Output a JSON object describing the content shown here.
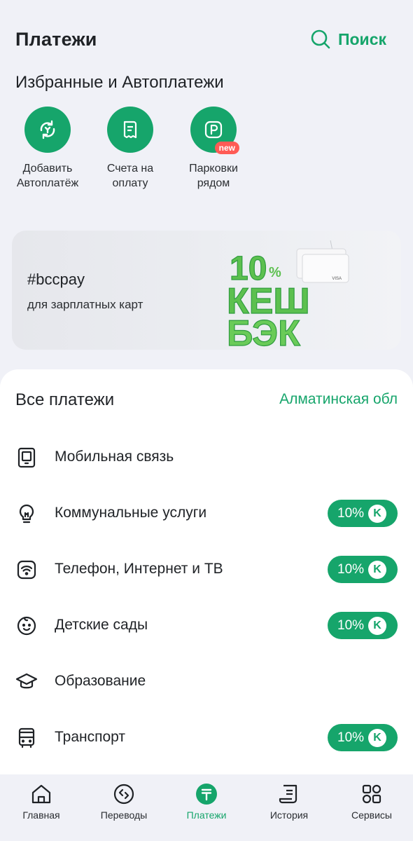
{
  "header": {
    "title": "Платежи",
    "search_label": "Поиск"
  },
  "favorites": {
    "title": "Избранные и Автоплатежи",
    "items": [
      {
        "label": "Добавить\nАвтоплатёж",
        "icon": "autopay-icon"
      },
      {
        "label": "Счета на\nоплату",
        "icon": "invoice-icon"
      },
      {
        "label": "Парковки\nрядом",
        "icon": "parking-icon",
        "badge": "new"
      }
    ]
  },
  "banner": {
    "tag": "#bccpay",
    "subtitle": "для зарплатных карт",
    "promo_percent": "10",
    "promo_percent_sign": "%",
    "promo_line1": "КЕШ",
    "promo_line2": "БЭК"
  },
  "all_payments": {
    "title": "Все платежи",
    "region": "Алматинская обл",
    "items": [
      {
        "label": "Мобильная связь",
        "icon": "mobile-phone-icon",
        "cashback": ""
      },
      {
        "label": "Коммунальные услуги",
        "icon": "lightbulb-icon",
        "cashback": "10%"
      },
      {
        "label": "Телефон, Интернет и ТВ",
        "icon": "wifi-icon",
        "cashback": "10%"
      },
      {
        "label": "Детские сады",
        "icon": "child-face-icon",
        "cashback": "10%"
      },
      {
        "label": "Образование",
        "icon": "graduation-cap-icon",
        "cashback": ""
      },
      {
        "label": "Транспорт",
        "icon": "bus-icon",
        "cashback": "10%"
      }
    ],
    "cashback_coin": "K"
  },
  "tabbar": {
    "items": [
      {
        "label": "Главная",
        "icon": "home-icon"
      },
      {
        "label": "Переводы",
        "icon": "transfers-icon"
      },
      {
        "label": "Платежи",
        "icon": "tenge-icon",
        "active": true
      },
      {
        "label": "История",
        "icon": "history-icon"
      },
      {
        "label": "Сервисы",
        "icon": "services-icon"
      }
    ]
  },
  "colors": {
    "accent": "#16a56b",
    "badge_new": "#ff5b55",
    "background": "#f0f1f7"
  }
}
